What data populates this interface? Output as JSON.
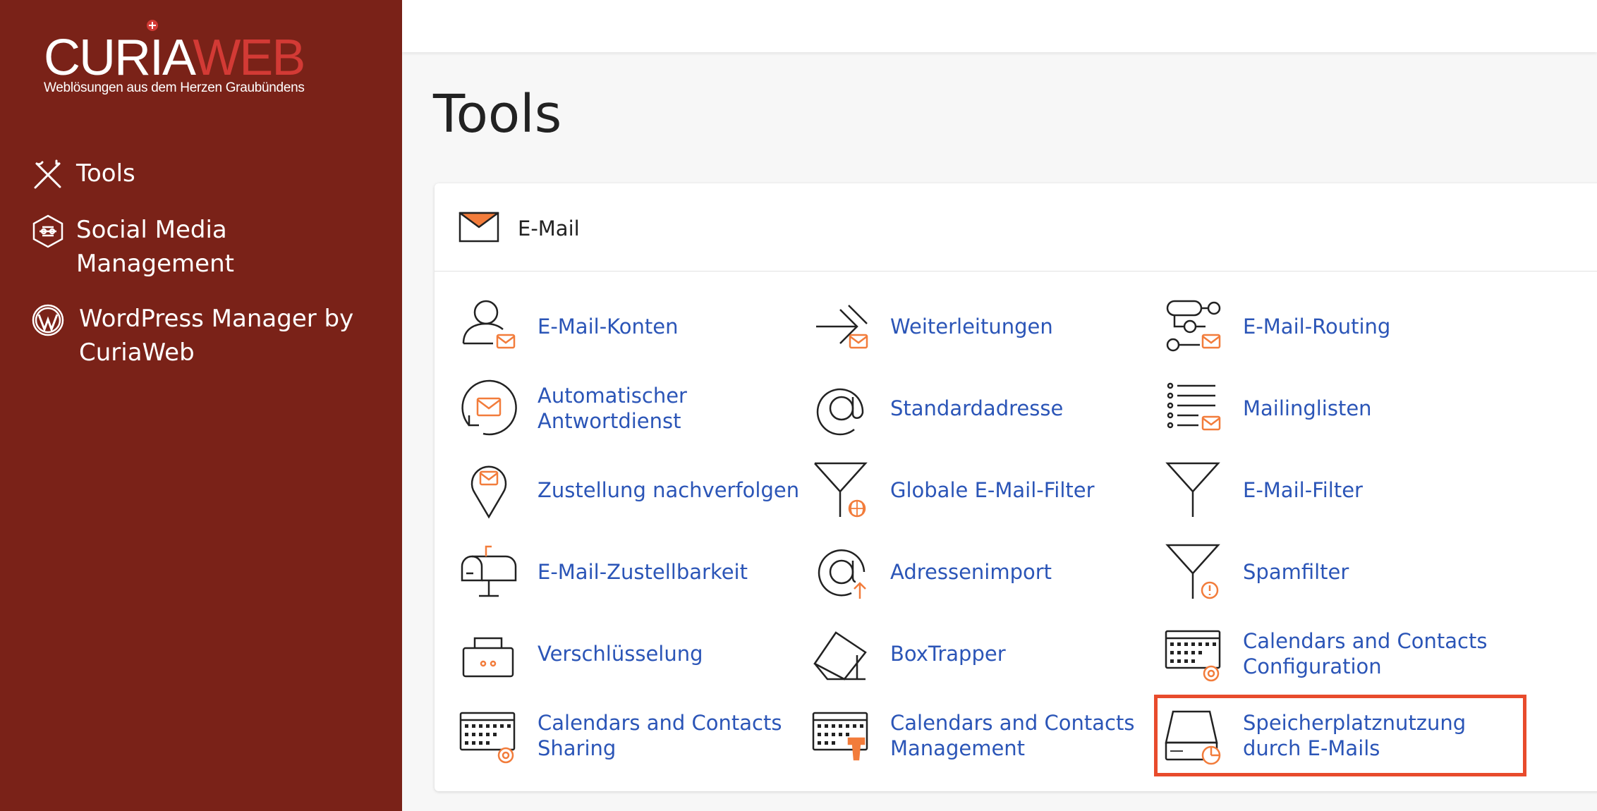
{
  "logo": {
    "word1": "CURIA",
    "word2": "WEB",
    "tagline": "Weblösungen aus dem Herzen Graubündens"
  },
  "sidebar": {
    "items": [
      {
        "label": "Tools",
        "icon": "tools-icon"
      },
      {
        "label": "Social Media Management",
        "icon": "social-media-icon"
      },
      {
        "label": "WordPress Manager by CuriaWeb",
        "icon": "wordpress-icon"
      }
    ]
  },
  "page": {
    "title": "Tools"
  },
  "email_section": {
    "title": "E-Mail",
    "icon": "envelope-icon",
    "tools": [
      {
        "label": "E-Mail-Konten",
        "icon": "user-mail-icon"
      },
      {
        "label": "Weiterleitungen",
        "icon": "forward-icon"
      },
      {
        "label": "E-Mail-Routing",
        "icon": "routing-icon"
      },
      {
        "label": "Automatischer Antwortdienst",
        "icon": "autoresponder-icon"
      },
      {
        "label": "Standardadresse",
        "icon": "at-icon"
      },
      {
        "label": "Mailinglisten",
        "icon": "list-icon"
      },
      {
        "label": "Zustellung nachverfolgen",
        "icon": "location-pin-icon"
      },
      {
        "label": "Globale E-Mail-Filter",
        "icon": "global-filter-icon"
      },
      {
        "label": "E-Mail-Filter",
        "icon": "filter-icon"
      },
      {
        "label": "E-Mail-Zustellbarkeit",
        "icon": "mailbox-icon"
      },
      {
        "label": "Adressenimport",
        "icon": "at-import-icon"
      },
      {
        "label": "Spamfilter",
        "icon": "spam-filter-icon"
      },
      {
        "label": "Verschlüsselung",
        "icon": "encryption-icon"
      },
      {
        "label": "BoxTrapper",
        "icon": "boxtrapper-icon"
      },
      {
        "label": "Calendars and Contacts Configuration",
        "icon": "calendar-at-icon"
      },
      {
        "label": "Calendars and Contacts Sharing",
        "icon": "calendar-share-icon"
      },
      {
        "label": "Calendars and Contacts Management",
        "icon": "calendar-manage-icon"
      },
      {
        "label": "Speicherplatznutzung durch E-Mails",
        "icon": "disk-usage-icon"
      }
    ]
  },
  "colors": {
    "sidebar": "#7a2218",
    "link": "#2b55b7",
    "accent": "#f27c3b",
    "highlight": "#e84b2c"
  }
}
